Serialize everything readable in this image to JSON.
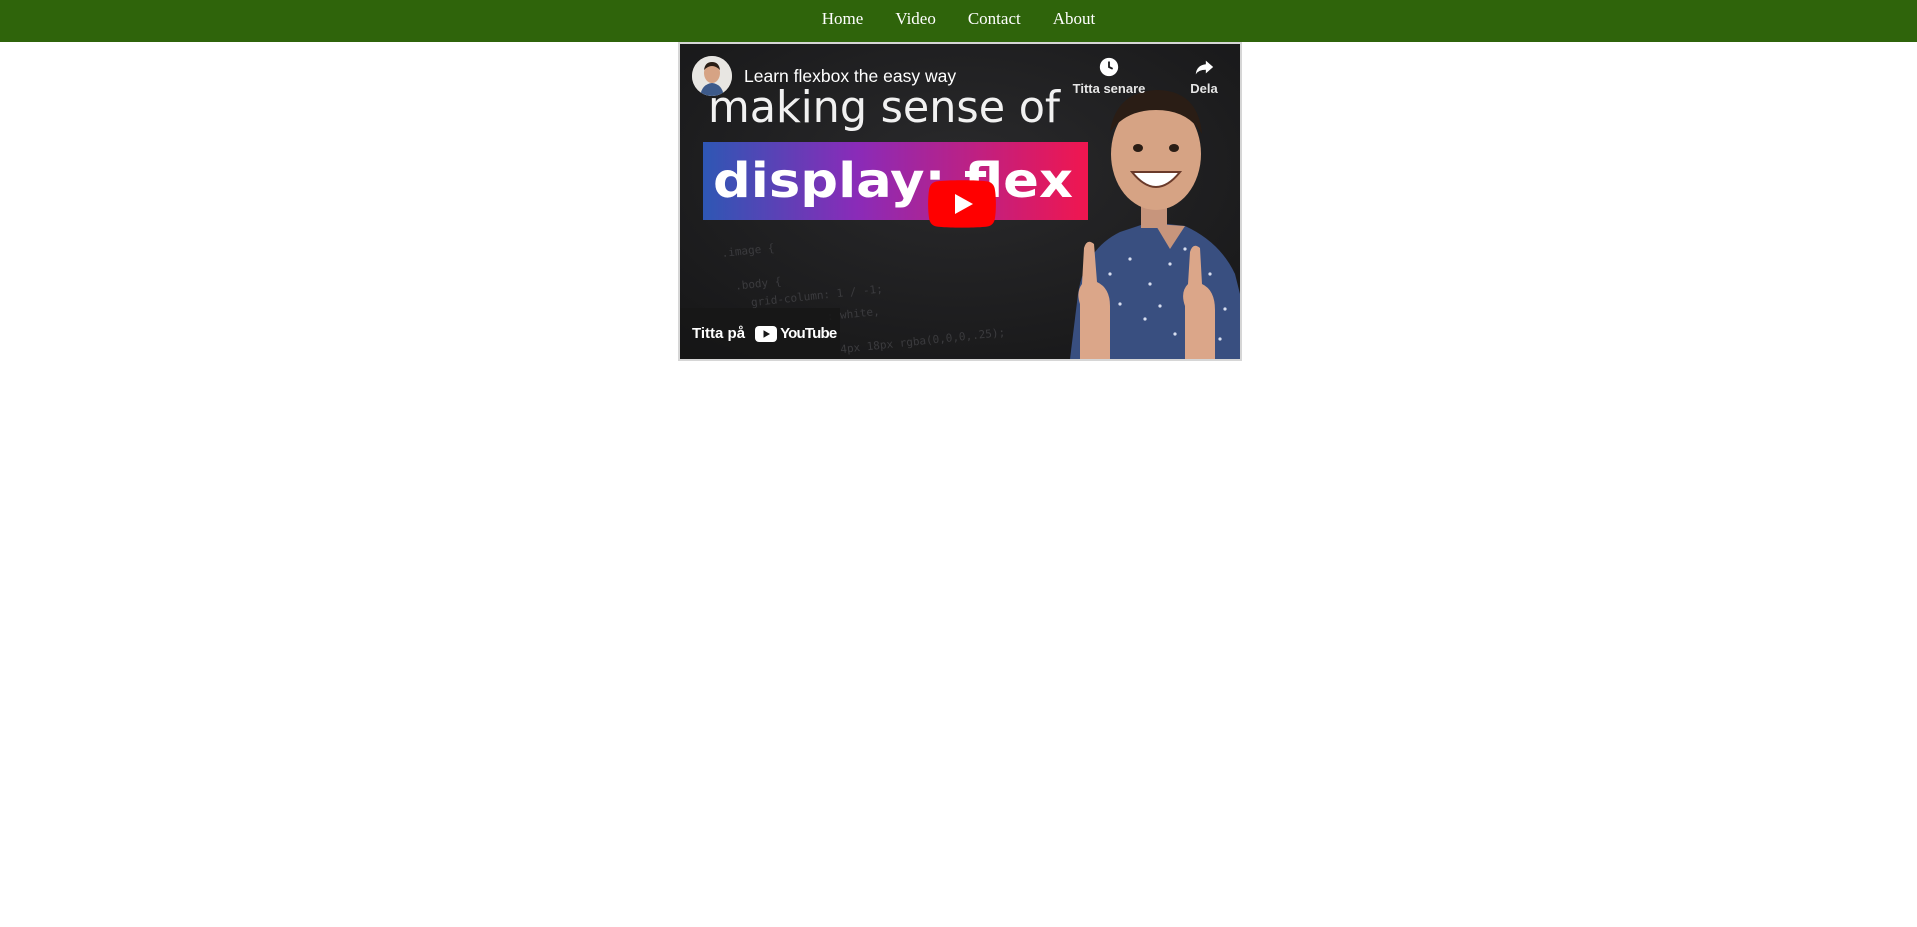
{
  "nav": {
    "items": [
      {
        "label": "Home"
      },
      {
        "label": "Video"
      },
      {
        "label": "Contact"
      },
      {
        "label": "About"
      }
    ],
    "background_color": "#2f640b"
  },
  "video": {
    "title": "Learn flexbox the easy way",
    "thumbnail": {
      "headline": "making sense of",
      "banner_text": "display: flex",
      "code_lines": [
        ".image { ",
        ".body {",
        "grid-column: 1 / -1;",
        ": white,",
        "4px 18px rgba(0,0,0,.25);"
      ]
    },
    "actions": {
      "watch_later": {
        "label": "Titta senare",
        "icon": "clock-icon"
      },
      "share": {
        "label": "Dela",
        "icon": "share-icon"
      }
    },
    "watch_on": {
      "label": "Titta på",
      "brand": "YouTube"
    },
    "play_icon": "play-icon",
    "accent_color": "#ff0000"
  }
}
